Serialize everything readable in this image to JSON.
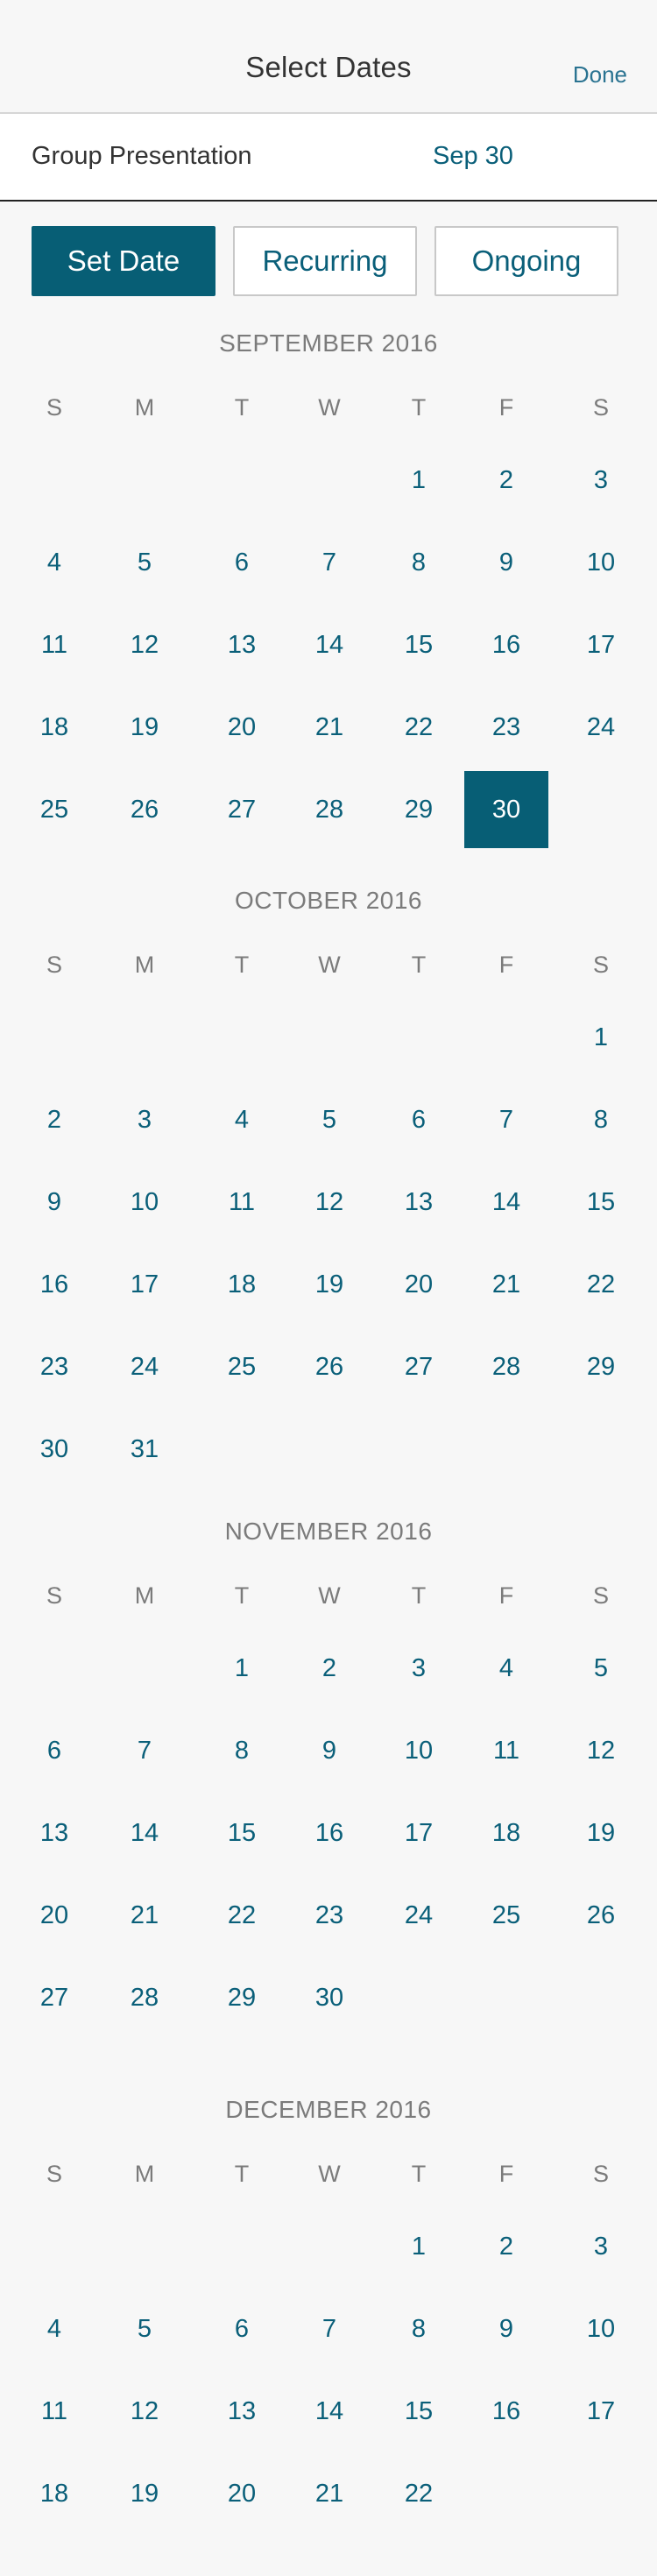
{
  "header": {
    "title": "Select Dates",
    "done_label": "Done"
  },
  "event": {
    "name": "Group Presentation",
    "date": "Sep 30"
  },
  "modes": {
    "set_date": "Set Date",
    "recurring": "Recurring",
    "ongoing": "Ongoing",
    "active": "set_date"
  },
  "weekday_labels": [
    "S",
    "M",
    "T",
    "W",
    "T",
    "F",
    "S"
  ],
  "months": [
    {
      "title": "SEPTEMBER 2016",
      "first_weekday": 4,
      "days_shown": 30,
      "selected_day": 30
    },
    {
      "title": "OCTOBER 2016",
      "first_weekday": 6,
      "days_shown": 31,
      "selected_day": null
    },
    {
      "title": "NOVEMBER 2016",
      "first_weekday": 2,
      "days_shown": 30,
      "selected_day": null
    },
    {
      "title": "DECEMBER 2016",
      "first_weekday": 4,
      "days_shown": 22,
      "selected_day": null
    }
  ],
  "colors": {
    "accent": "#075e75",
    "day_text": "#0a5f79",
    "muted_text": "#7b7b7b",
    "background": "#f7f7f7"
  }
}
